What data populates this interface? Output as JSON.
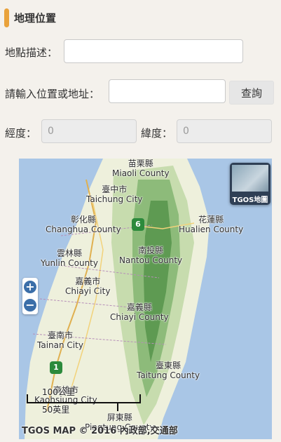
{
  "section": {
    "title": "地理位置"
  },
  "form": {
    "description_label": "地點描述：",
    "description_value": "",
    "address_label": "請輸入位置或地址：",
    "address_value": "",
    "query_button": "查詢",
    "longitude_label": "經度：",
    "longitude_value": "0",
    "latitude_label": "緯度：",
    "latitude_value": "0"
  },
  "map": {
    "layer_button": "TGOS地圖",
    "zoom_in": "+",
    "zoom_out": "−",
    "highway_1": "1",
    "highway_6": "6",
    "places": [
      {
        "zh": "苗栗縣",
        "en": "Miaoli County"
      },
      {
        "zh": "臺中市",
        "en": "Taichung City"
      },
      {
        "zh": "彰化縣",
        "en": "Changhua County"
      },
      {
        "zh": "花蓮縣",
        "en": "Hualien County"
      },
      {
        "zh": "南投縣",
        "en": "Nantou County"
      },
      {
        "zh": "雲林縣",
        "en": "Yunlin County"
      },
      {
        "zh": "嘉義市",
        "en": "Chiayi City"
      },
      {
        "zh": "嘉義縣",
        "en": "Chiayi County"
      },
      {
        "zh": "臺南市",
        "en": "Tainan City"
      },
      {
        "zh": "臺東縣",
        "en": "Taitung County"
      },
      {
        "zh": "高雄市",
        "en": "Kaohsiung City"
      },
      {
        "zh": "屏東縣",
        "en": "Pingtung County"
      }
    ],
    "scale_top": "100公里",
    "scale_bottom": "50英里",
    "copyright": "TGOS MAP © 2016 內政部,交通部"
  },
  "colors": {
    "accent": "#e9a23b",
    "water": "#a9c6e6",
    "land": "#eef0dc",
    "mountain": "#5e9a52"
  }
}
